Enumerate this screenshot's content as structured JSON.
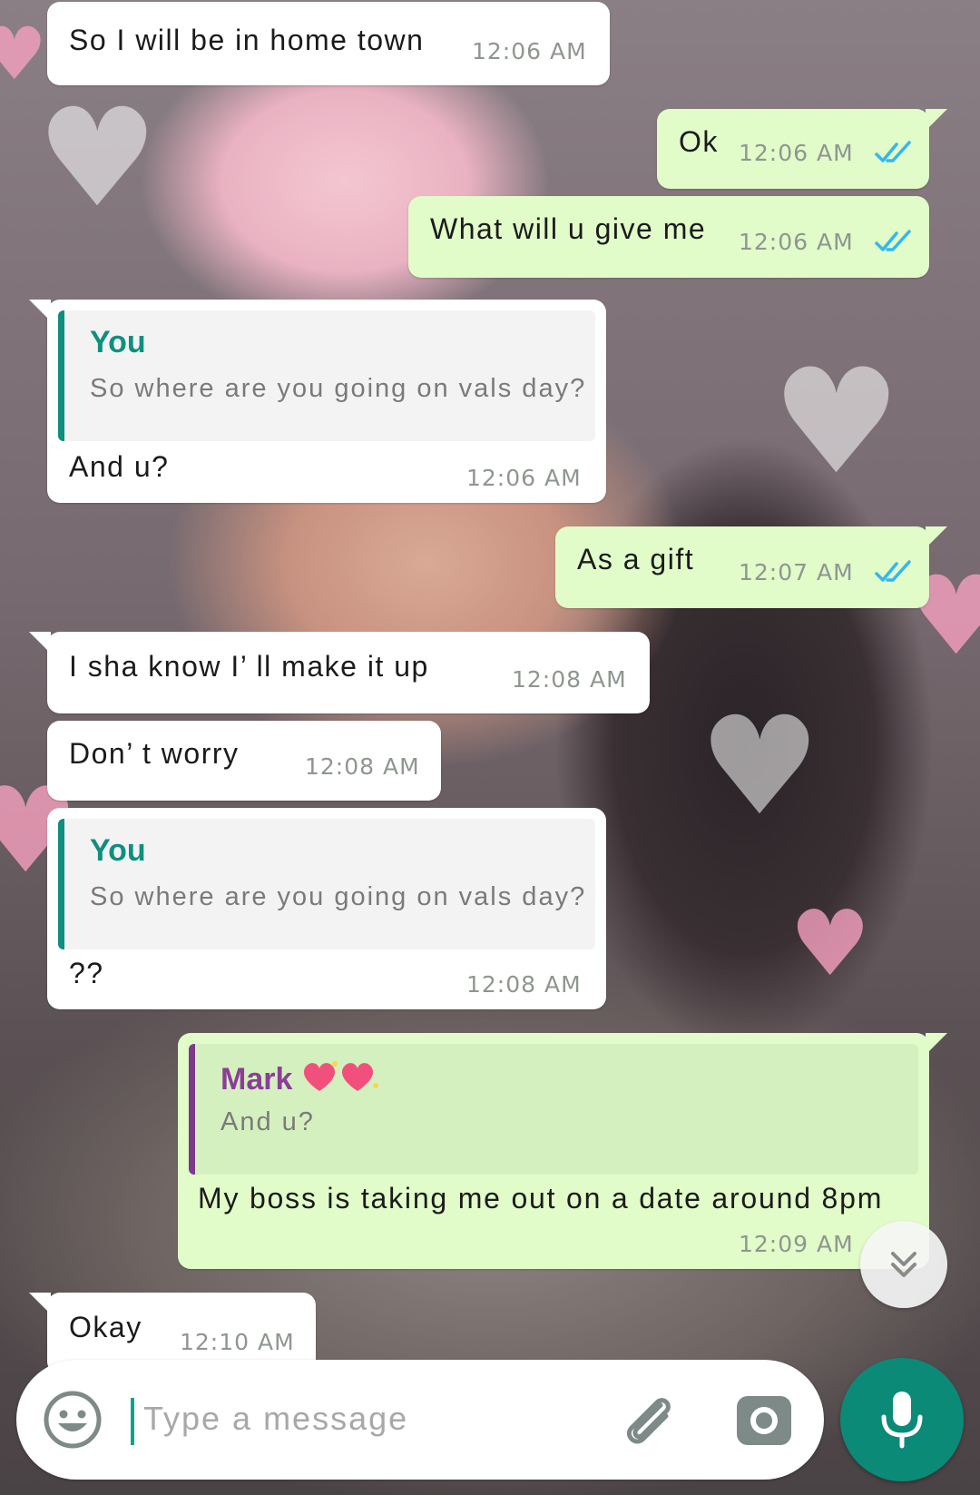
{
  "messages": [
    {
      "direction": "in",
      "text": "So I will be in home town",
      "time": "12:06 AM"
    },
    {
      "direction": "out",
      "text": "Ok",
      "time": "12:06 AM",
      "status": "read"
    },
    {
      "direction": "out",
      "text": "What will u give me",
      "time": "12:06 AM",
      "status": "read"
    },
    {
      "direction": "in",
      "reply": {
        "name": "You",
        "text": "So where are you going on vals day?"
      },
      "text": "And u?",
      "time": "12:06 AM"
    },
    {
      "direction": "out",
      "text": "As a gift",
      "time": "12:07 AM",
      "status": "read"
    },
    {
      "direction": "in",
      "text": "I sha know I’ ll make it up",
      "time": "12:08 AM"
    },
    {
      "direction": "in",
      "text": "Don’ t worry",
      "time": "12:08 AM"
    },
    {
      "direction": "in",
      "reply": {
        "name": "You",
        "text": "So where are you going on vals day?"
      },
      "text": "??",
      "time": "12:08 AM"
    },
    {
      "direction": "out",
      "reply": {
        "name": "Mark",
        "text": "And u?"
      },
      "text": "My boss is taking me out on a date around 8pm",
      "time": "12:09 AM",
      "status": "read"
    },
    {
      "direction": "in",
      "text": "Okay",
      "time": "12:10 AM"
    }
  ],
  "composer": {
    "placeholder": "Type a message"
  },
  "icons": {
    "emoji": "emoji-icon",
    "attach": "paperclip-icon",
    "camera": "camera-icon",
    "mic": "microphone-icon",
    "scroll": "double-chevron-down-icon",
    "read": "double-check-icon",
    "heart": "heart-icon"
  },
  "colors": {
    "incoming_bubble": "#ffffff",
    "outgoing_bubble": "#e1fbc9",
    "accent": "#0b8a78",
    "reply_you": "#0f8f7e",
    "reply_mark": "#7b3a8a",
    "read_ticks": "#34b7f1"
  }
}
